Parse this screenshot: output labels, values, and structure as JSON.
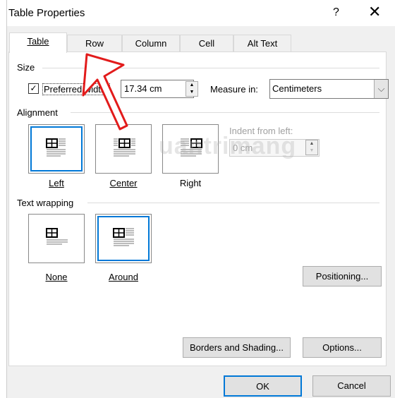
{
  "window": {
    "title": "Table Properties",
    "help": "?",
    "close": "✕"
  },
  "tabs": [
    {
      "label": "Table",
      "active": true
    },
    {
      "label": "Row"
    },
    {
      "label": "Column"
    },
    {
      "label": "Cell"
    },
    {
      "label": "Alt Text"
    }
  ],
  "size": {
    "group": "Size",
    "preferred_width_label": "Preferred width:",
    "preferred_width_checked": true,
    "width_value": "17.34 cm",
    "measure_label": "Measure in:",
    "measure_value": "Centimeters"
  },
  "alignment": {
    "group": "Alignment",
    "options": [
      {
        "label": "Left",
        "selected": true
      },
      {
        "label": "Center"
      },
      {
        "label": "Right"
      }
    ],
    "indent_label": "Indent from left:",
    "indent_value": "0 cm"
  },
  "wrapping": {
    "group": "Text wrapping",
    "options": [
      {
        "label": "None"
      },
      {
        "label": "Around",
        "selected": true
      }
    ]
  },
  "buttons": {
    "positioning": "Positioning...",
    "borders": "Borders and Shading...",
    "options": "Options...",
    "ok": "OK",
    "cancel": "Cancel"
  },
  "colors": {
    "accent": "#0078d7",
    "arrow": "#e21b1b"
  },
  "watermark": "Quantrimang"
}
